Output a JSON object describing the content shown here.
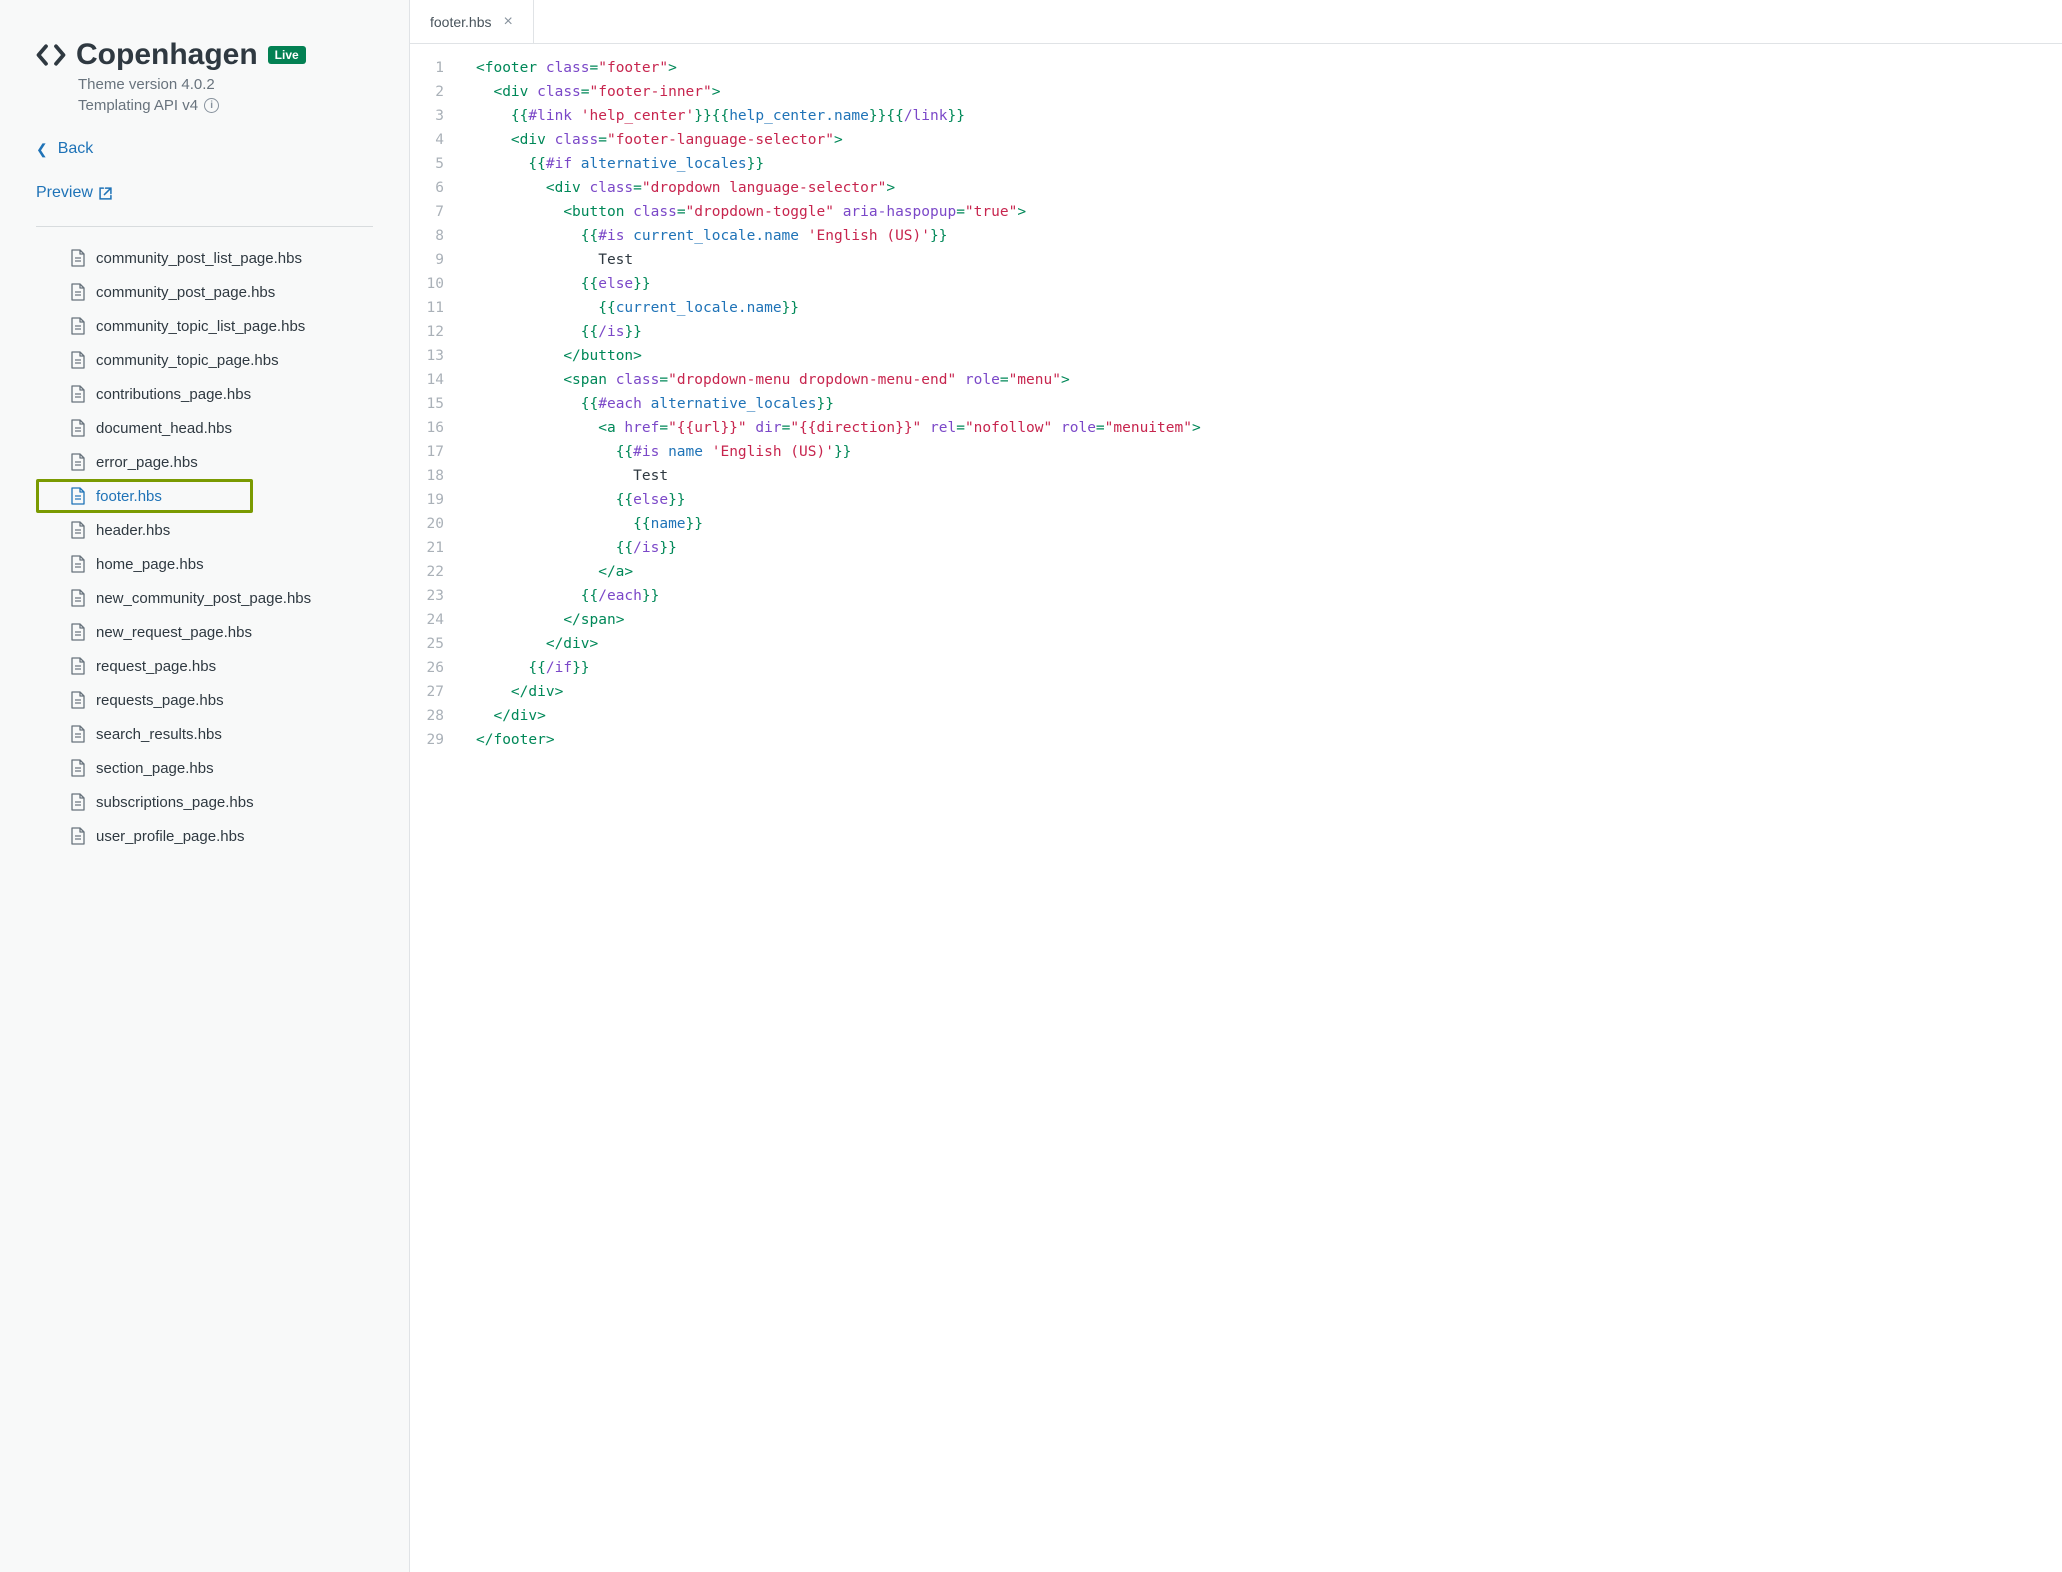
{
  "theme": {
    "name": "Copenhagen",
    "live_badge": "Live",
    "version_line": "Theme version 4.0.2",
    "api_line": "Templating API v4"
  },
  "nav": {
    "back": "Back",
    "preview": "Preview"
  },
  "files": [
    "community_post_list_page.hbs",
    "community_post_page.hbs",
    "community_topic_list_page.hbs",
    "community_topic_page.hbs",
    "contributions_page.hbs",
    "document_head.hbs",
    "error_page.hbs",
    "footer.hbs",
    "header.hbs",
    "home_page.hbs",
    "new_community_post_page.hbs",
    "new_request_page.hbs",
    "request_page.hbs",
    "requests_page.hbs",
    "search_results.hbs",
    "section_page.hbs",
    "subscriptions_page.hbs",
    "user_profile_page.hbs"
  ],
  "active_file": "footer.hbs",
  "tab": {
    "label": "footer.hbs"
  },
  "code_lines": [
    [
      [
        "tag",
        "<footer "
      ],
      [
        "attr",
        "class"
      ],
      [
        "tag",
        "="
      ],
      [
        "str",
        "\"footer\""
      ],
      [
        "tag",
        ">"
      ]
    ],
    [
      [
        "text",
        "  "
      ],
      [
        "tag",
        "<div "
      ],
      [
        "attr",
        "class"
      ],
      [
        "tag",
        "="
      ],
      [
        "str",
        "\"footer-inner\""
      ],
      [
        "tag",
        ">"
      ]
    ],
    [
      [
        "text",
        "    "
      ],
      [
        "tag",
        "{{"
      ],
      [
        "attr",
        "#link "
      ],
      [
        "str",
        "'help_center'"
      ],
      [
        "tag",
        "}}{{"
      ],
      [
        "var",
        "help_center.name"
      ],
      [
        "tag",
        "}}{{"
      ],
      [
        "attr",
        "/link"
      ],
      [
        "tag",
        "}}"
      ]
    ],
    [
      [
        "text",
        "    "
      ],
      [
        "tag",
        "<div "
      ],
      [
        "attr",
        "class"
      ],
      [
        "tag",
        "="
      ],
      [
        "str",
        "\"footer-language-selector\""
      ],
      [
        "tag",
        ">"
      ]
    ],
    [
      [
        "text",
        "      "
      ],
      [
        "tag",
        "{{"
      ],
      [
        "attr",
        "#if "
      ],
      [
        "var",
        "alternative_locales"
      ],
      [
        "tag",
        "}}"
      ]
    ],
    [
      [
        "text",
        "        "
      ],
      [
        "tag",
        "<div "
      ],
      [
        "attr",
        "class"
      ],
      [
        "tag",
        "="
      ],
      [
        "str",
        "\"dropdown language-selector\""
      ],
      [
        "tag",
        ">"
      ]
    ],
    [
      [
        "text",
        "          "
      ],
      [
        "tag",
        "<button "
      ],
      [
        "attr",
        "class"
      ],
      [
        "tag",
        "="
      ],
      [
        "str",
        "\"dropdown-toggle\""
      ],
      [
        "tag",
        " "
      ],
      [
        "attr",
        "aria-haspopup"
      ],
      [
        "tag",
        "="
      ],
      [
        "str",
        "\"true\""
      ],
      [
        "tag",
        ">"
      ]
    ],
    [
      [
        "text",
        "            "
      ],
      [
        "tag",
        "{{"
      ],
      [
        "attr",
        "#is "
      ],
      [
        "var",
        "current_locale.name "
      ],
      [
        "str",
        "'English (US)'"
      ],
      [
        "tag",
        "}}"
      ]
    ],
    [
      [
        "text",
        "              Test"
      ]
    ],
    [
      [
        "text",
        "            "
      ],
      [
        "tag",
        "{{"
      ],
      [
        "attr",
        "else"
      ],
      [
        "tag",
        "}}"
      ]
    ],
    [
      [
        "text",
        "              "
      ],
      [
        "tag",
        "{{"
      ],
      [
        "var",
        "current_locale.name"
      ],
      [
        "tag",
        "}}"
      ]
    ],
    [
      [
        "text",
        "            "
      ],
      [
        "tag",
        "{{"
      ],
      [
        "attr",
        "/is"
      ],
      [
        "tag",
        "}}"
      ]
    ],
    [
      [
        "text",
        "          "
      ],
      [
        "tag",
        "</button>"
      ]
    ],
    [
      [
        "text",
        "          "
      ],
      [
        "tag",
        "<span "
      ],
      [
        "attr",
        "class"
      ],
      [
        "tag",
        "="
      ],
      [
        "str",
        "\"dropdown-menu dropdown-menu-end\""
      ],
      [
        "tag",
        " "
      ],
      [
        "attr",
        "role"
      ],
      [
        "tag",
        "="
      ],
      [
        "str",
        "\"menu\""
      ],
      [
        "tag",
        ">"
      ]
    ],
    [
      [
        "text",
        "            "
      ],
      [
        "tag",
        "{{"
      ],
      [
        "attr",
        "#each "
      ],
      [
        "var",
        "alternative_locales"
      ],
      [
        "tag",
        "}}"
      ]
    ],
    [
      [
        "text",
        "              "
      ],
      [
        "tag",
        "<a "
      ],
      [
        "attr",
        "href"
      ],
      [
        "tag",
        "="
      ],
      [
        "str",
        "\"{{url}}\""
      ],
      [
        "tag",
        " "
      ],
      [
        "attr",
        "dir"
      ],
      [
        "tag",
        "="
      ],
      [
        "str",
        "\"{{direction}}\""
      ],
      [
        "tag",
        " "
      ],
      [
        "attr",
        "rel"
      ],
      [
        "tag",
        "="
      ],
      [
        "str",
        "\"nofollow\""
      ],
      [
        "tag",
        " "
      ],
      [
        "attr",
        "role"
      ],
      [
        "tag",
        "="
      ],
      [
        "str",
        "\"menuitem\""
      ],
      [
        "tag",
        ">"
      ]
    ],
    [
      [
        "text",
        "                "
      ],
      [
        "tag",
        "{{"
      ],
      [
        "attr",
        "#is "
      ],
      [
        "var",
        "name "
      ],
      [
        "str",
        "'English (US)'"
      ],
      [
        "tag",
        "}}"
      ]
    ],
    [
      [
        "text",
        "                  Test"
      ]
    ],
    [
      [
        "text",
        "                "
      ],
      [
        "tag",
        "{{"
      ],
      [
        "attr",
        "else"
      ],
      [
        "tag",
        "}}"
      ]
    ],
    [
      [
        "text",
        "                  "
      ],
      [
        "tag",
        "{{"
      ],
      [
        "var",
        "name"
      ],
      [
        "tag",
        "}}"
      ]
    ],
    [
      [
        "text",
        "                "
      ],
      [
        "tag",
        "{{"
      ],
      [
        "attr",
        "/is"
      ],
      [
        "tag",
        "}}"
      ]
    ],
    [
      [
        "text",
        "              "
      ],
      [
        "tag",
        "</a>"
      ]
    ],
    [
      [
        "text",
        "            "
      ],
      [
        "tag",
        "{{"
      ],
      [
        "attr",
        "/each"
      ],
      [
        "tag",
        "}}"
      ]
    ],
    [
      [
        "text",
        "          "
      ],
      [
        "tag",
        "</span>"
      ]
    ],
    [
      [
        "text",
        "        "
      ],
      [
        "tag",
        "</div>"
      ]
    ],
    [
      [
        "text",
        "      "
      ],
      [
        "tag",
        "{{"
      ],
      [
        "attr",
        "/if"
      ],
      [
        "tag",
        "}}"
      ]
    ],
    [
      [
        "text",
        "    "
      ],
      [
        "tag",
        "</div>"
      ]
    ],
    [
      [
        "text",
        "  "
      ],
      [
        "tag",
        "</div>"
      ]
    ],
    [
      [
        "tag",
        "</footer>"
      ]
    ]
  ]
}
